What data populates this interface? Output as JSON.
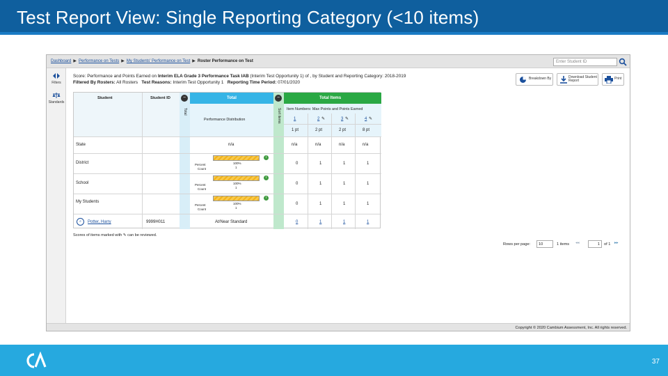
{
  "slide": {
    "title": "Test Report View: Single Reporting Category (<10 items)",
    "page_number": "37",
    "colors": {
      "title_bar": "#0f5f9e",
      "bottom_bar": "#26a9df",
      "total_header": "#36b4e6",
      "items_header": "#2aa844"
    }
  },
  "breadcrumb": [
    "Dashboard",
    "Performance on Tests",
    "My Students' Performance on Test",
    "Roster Performance on Test"
  ],
  "search": {
    "placeholder": "Enter Student ID",
    "icon": "search-icon"
  },
  "sidebar": [
    {
      "label": "Filters",
      "icon": "filters-icon"
    },
    {
      "label": "Standards",
      "icon": "scales-icon"
    }
  ],
  "info": {
    "score_prefix": "Score: Performance and Points Earned on",
    "test_name": "Interim ELA Grade 3 Performance Task IAB",
    "score_suffix": "(Interim Test Opportunity 1) of , by Student and Reporting Category: 2018-2019",
    "filtered_label": "Filtered By Rosters:",
    "filtered_value": "All Rosters",
    "reasons_label": "Test Reasons:",
    "reasons_value": "Interim Test Opportunity 1",
    "period_label": "Reporting Time Period:",
    "period_value": "07/01/2020"
  },
  "toolbar": {
    "breakdown": "Breakdown By",
    "download": "Download Student Report",
    "print": "Print"
  },
  "table": {
    "col_student": "Student",
    "col_student_id": "Student ID",
    "col_total": "Total",
    "col_perf_dist": "Performance Distribution",
    "col_total_items": "Total Items",
    "col_item_numbers": "Item Numbers: Max Points and Points Earned",
    "side_total_label": "Total",
    "side_items_label": "Sort items",
    "items": [
      {
        "number": "1",
        "points": "1 pt",
        "editable": false
      },
      {
        "number": "2",
        "points": "2 pt",
        "editable": true
      },
      {
        "number": "3",
        "points": "2 pt",
        "editable": true
      },
      {
        "number": "4",
        "points": "8 pt",
        "editable": true
      }
    ],
    "rows": [
      {
        "name": "State",
        "id": "",
        "total": "n/a",
        "dist": false,
        "items": [
          "n/a",
          "n/a",
          "n/a",
          "n/a"
        ]
      },
      {
        "name": "District",
        "id": "",
        "total": "",
        "dist": true,
        "percent": "100%",
        "count": "1",
        "items": [
          "0",
          "1",
          "1",
          "1"
        ]
      },
      {
        "name": "School",
        "id": "",
        "total": "",
        "dist": true,
        "percent": "100%",
        "count": "1",
        "items": [
          "0",
          "1",
          "1",
          "1"
        ]
      },
      {
        "name": "My Students",
        "id": "",
        "total": "",
        "dist": true,
        "percent": "100%",
        "count": "1",
        "items": [
          "0",
          "1",
          "1",
          "1"
        ]
      },
      {
        "name": "Potter, Harry",
        "id": "9999H011",
        "total": "At/Near Standard",
        "dist": false,
        "items": [
          "0",
          "1",
          "1",
          "1"
        ]
      }
    ],
    "percent_label": "Percent",
    "count_label": "Count"
  },
  "footer_note_before": "Scores of items marked with",
  "footer_note_after": "can be reviewed.",
  "pager": {
    "rows_label": "Rows per page:",
    "rows_value": "10",
    "items_label": "1 items",
    "page_value": "1",
    "of_label": "of 1"
  },
  "copyright": "Copyright © 2020 Cambium Assessment, Inc. All rights reserved."
}
